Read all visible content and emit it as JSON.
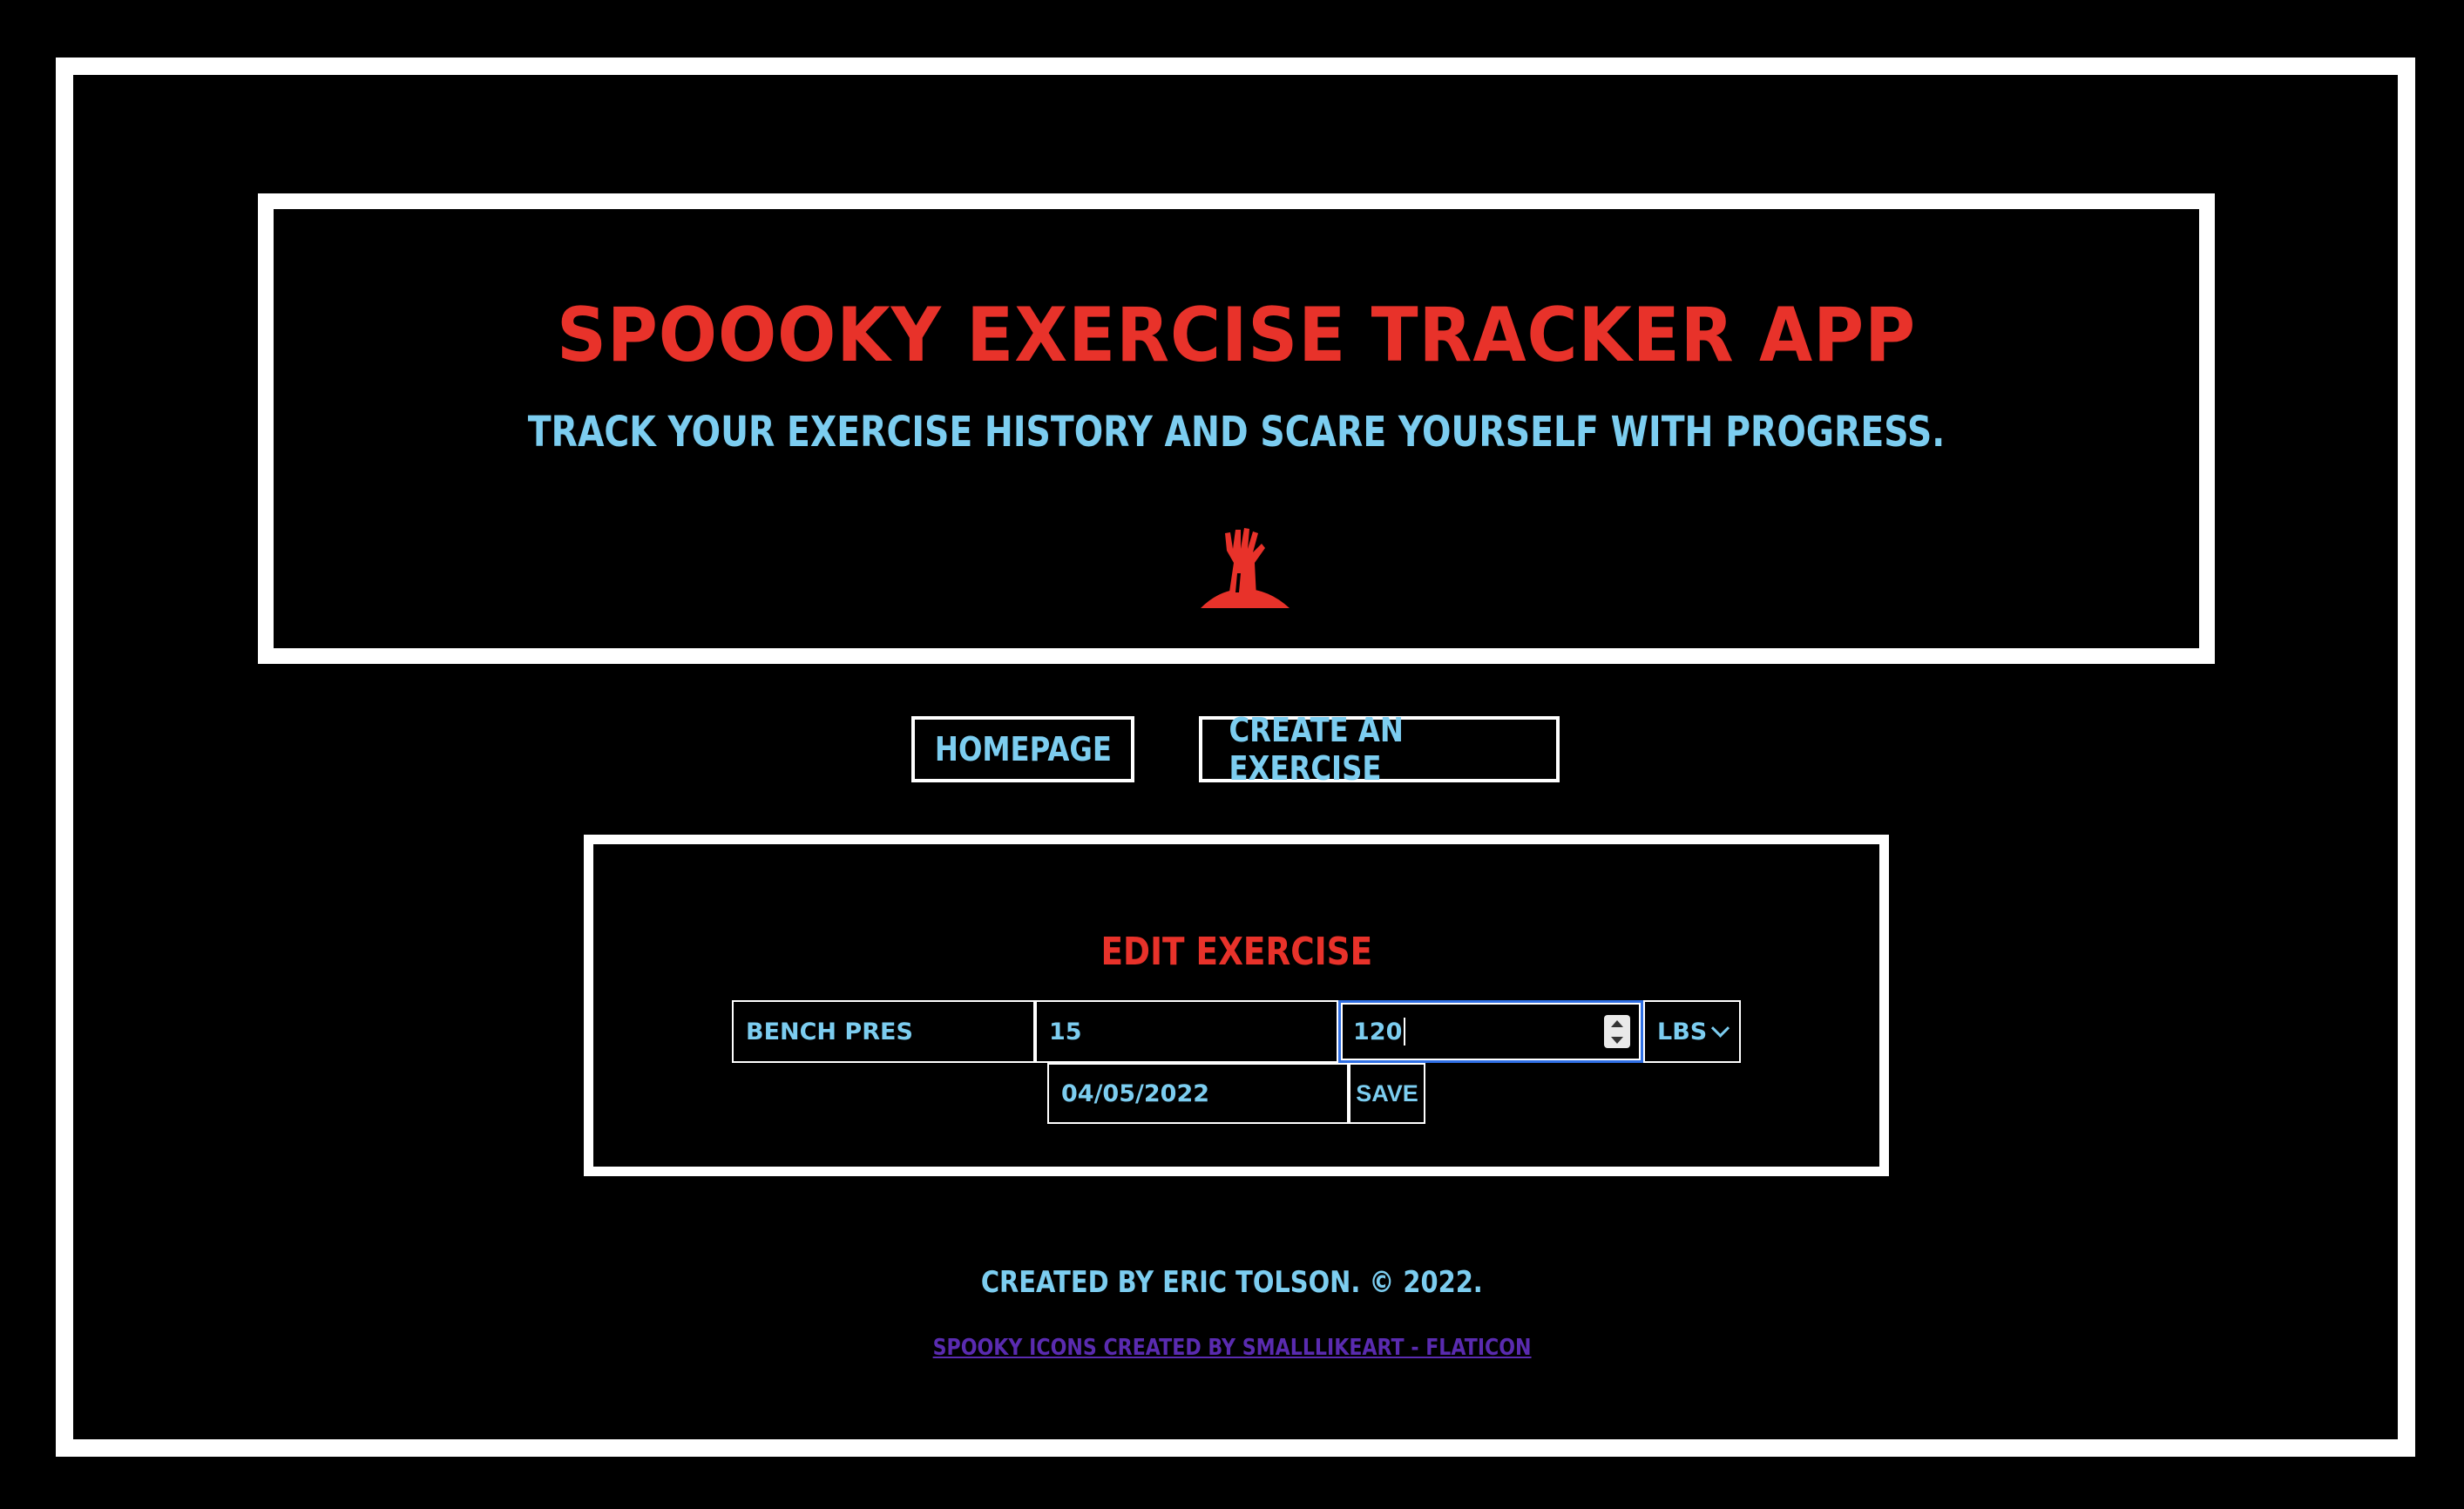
{
  "header": {
    "title": "Spoooky Exercise Tracker App",
    "subtitle": "Track your exercise history and scare yourself with progress.",
    "logo_icon": "zombie-hand-icon"
  },
  "nav": {
    "homepage_label": "Homepage",
    "create_label": "Create an Exercise"
  },
  "edit_form": {
    "title": "Edit Exercise",
    "name_value": "Bench Pres",
    "reps_value": "15",
    "weight_value": "120",
    "unit_value": "lbs",
    "unit_options": [
      "lbs"
    ],
    "date_value": "04/05/2022",
    "save_label": "Save"
  },
  "footer": {
    "credit": "Created by Eric Tolson. © 2022.",
    "attribution_link": "Spooky icons created by Smalllikeart - Flaticon"
  },
  "colors": {
    "background": "#000000",
    "frame": "#ffffff",
    "title_red": "#e8322a",
    "text_blue": "#7ccdf0",
    "link_purple": "#5a2bb0",
    "focus_blue": "#2f6fe4"
  }
}
